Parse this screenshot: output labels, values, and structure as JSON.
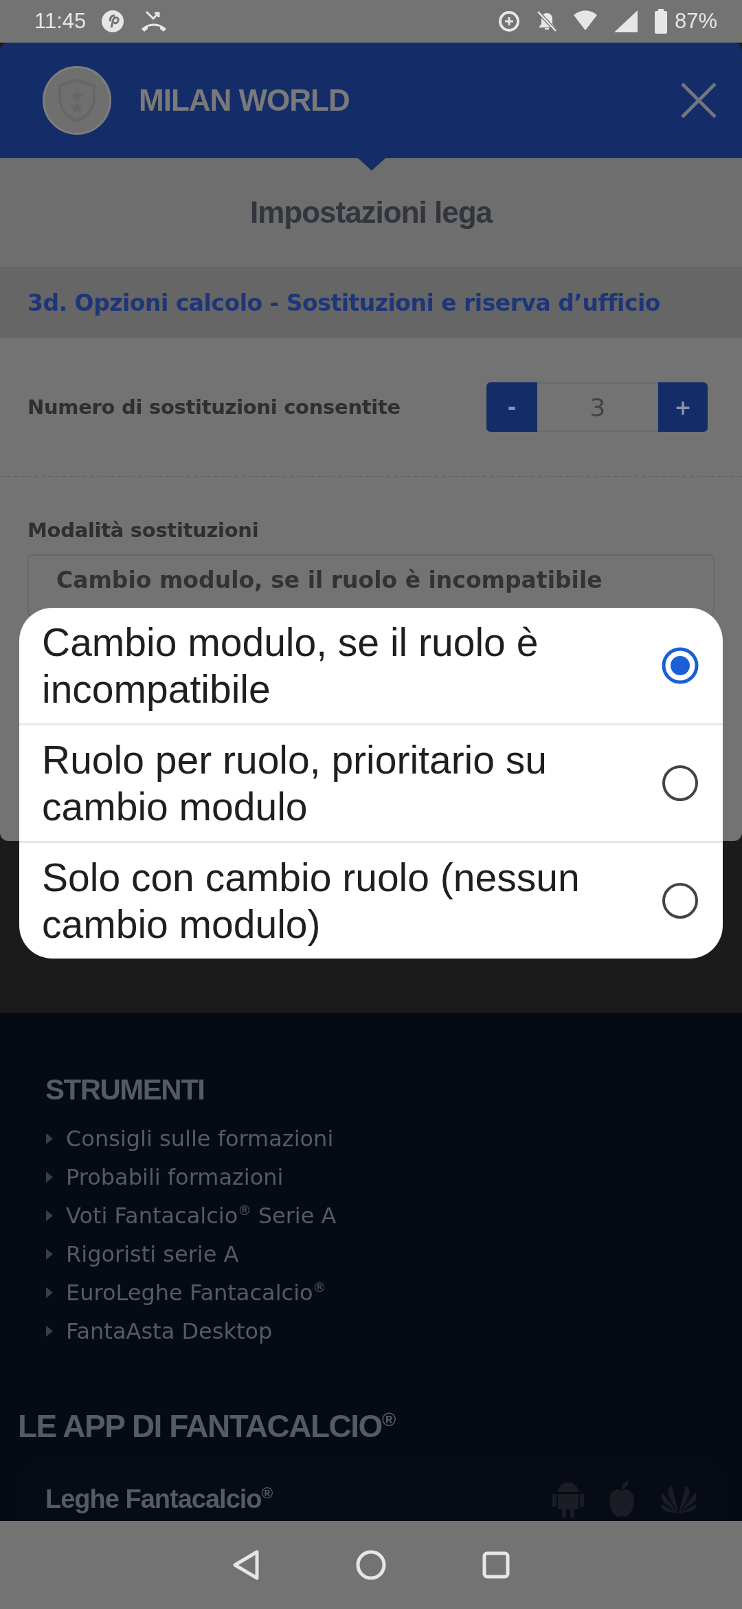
{
  "status_bar": {
    "time": "11:45",
    "battery": "87%"
  },
  "header": {
    "title": "MILAN WORLD"
  },
  "page_title": "Impostazioni lega",
  "section": {
    "title": "3d. Opzioni calcolo - Sostituzioni e riserva d’ufficio"
  },
  "substitutions": {
    "label": "Numero di sostituzioni consentite",
    "decrement": "-",
    "value": "3",
    "increment": "+"
  },
  "mode": {
    "label": "Modalità sostituzioni",
    "value": "Cambio modulo, se il ruolo è incompatibile"
  },
  "footer": {
    "tools_title": "STRUMENTI",
    "links": [
      "Consigli sulle formazioni",
      "Probabili formazioni",
      "Voti Fantacalcio$^{®}$ Serie A",
      "Rigoristi serie A",
      "EuroLeghe Fantacalcio$^{®}$",
      "FantaAsta Desktop"
    ],
    "apps_title": "LE APP DI FANTACALCIO$^{®}$",
    "app_name": "Leghe Fantacalcio$^{®}$"
  },
  "dialog": {
    "options": [
      {
        "label": "Cambio modulo, se il ruolo è incompatibile",
        "selected": true
      },
      {
        "label": "Ruolo per ruolo, prioritario su cambio modulo",
        "selected": false
      },
      {
        "label": "Solo con cambio ruolo (nessun cambio modulo)",
        "selected": false
      }
    ]
  }
}
